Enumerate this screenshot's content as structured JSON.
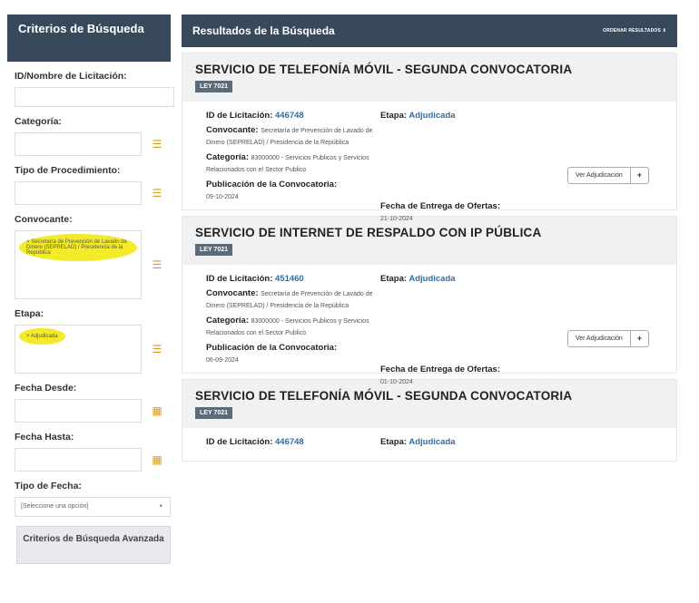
{
  "sidebar": {
    "header": "Criterios de Búsqueda",
    "id_label": "ID/Nombre de Licitación:",
    "categoria_label": "Categoría:",
    "tipo_proc_label": "Tipo de Procedimiento:",
    "convocante_label": "Convocante:",
    "convocante_value": "× Secretaría de Prevención de Lavado de Dinero (SEPRELAD) / Presidencia de la República",
    "etapa_label": "Etapa:",
    "etapa_value": "× Adjudicada",
    "fecha_desde_label": "Fecha Desde:",
    "fecha_hasta_label": "Fecha Hasta:",
    "tipo_fecha_label": "Tipo de Fecha:",
    "tipo_fecha_placeholder": "[Seleccione una opción]",
    "advanced_button": "Criterios de Búsqueda Avanzada"
  },
  "results": {
    "title": "Resultados de la Búsqueda",
    "sort_label": "ORDENAR RESULTADOS ⇕",
    "labels": {
      "id": "ID de Licitación:",
      "etapa": "Etapa:",
      "convocante": "Convocante:",
      "categoria": "Categoría:",
      "publicacion": "Publicación de la Convocatoria:",
      "entrega": "Fecha de Entrega de Ofertas:",
      "ver_button": "Ver Adjudicación",
      "plus_button": "+"
    },
    "cards": [
      {
        "title": "SERVICIO DE TELEFONÍA MÓVIL - SEGUNDA CONVOCATORIA",
        "badge": "LEY 7021",
        "id": "446748",
        "etapa": "Adjudicada",
        "convocante": "Secretaría de Prevención de Lavado de Dinero (SEPRELAD) / Presidencia de la República",
        "categoria": "83000000 - Servicios Publicos y Servicios Relacionados con el Sector Publico",
        "publicacion": "09-10-2024",
        "entrega": "21-10-2024"
      },
      {
        "title": "SERVICIO DE INTERNET DE RESPALDO CON IP PÚBLICA",
        "badge": "LEY 7021",
        "id": "451460",
        "etapa": "Adjudicada",
        "convocante": "Secretaría de Prevención de Lavado de Dinero (SEPRELAD) / Presidencia de la República",
        "categoria": "83000000 - Servicios Publicos y Servicios Relacionados con el Sector Publico",
        "publicacion": "06-09-2024",
        "entrega": "01-10-2024"
      },
      {
        "title": "SERVICIO DE TELEFONÍA MÓVIL - SEGUNDA CONVOCATORIA",
        "badge": "LEY 7021",
        "id": "446748",
        "etapa": "Adjudicada"
      }
    ]
  },
  "colors": {
    "header_bg": "#37495a",
    "link": "#2f6ea4",
    "highlight": "#f3ea2a",
    "list_icon": "#d59b1f"
  },
  "icons": {
    "list": "list-icon",
    "caret": "chevron-down-icon"
  }
}
